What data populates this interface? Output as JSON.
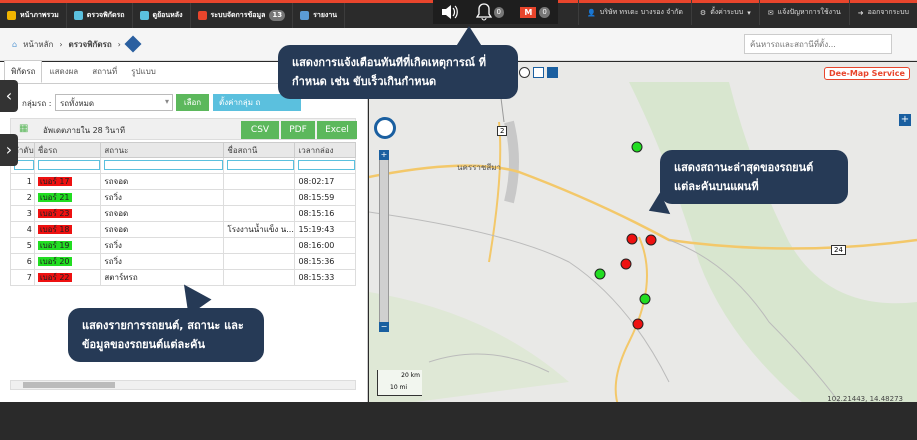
{
  "topnav": {
    "items": [
      {
        "label": "หน้าภาพรวม",
        "color": "#f0b400"
      },
      {
        "label": "ตรวจพิกัดรถ",
        "color": "#5bc0de"
      },
      {
        "label": "ดูย้อนหลัง",
        "color": "#5bc0de"
      },
      {
        "label": "ระบบจัดการข้อมูล",
        "color": "#e8452c",
        "badge": "13"
      },
      {
        "label": "รายงาน",
        "color": "#5b9bd5"
      }
    ],
    "alerts": {
      "bell_count": "0",
      "m_label": "M",
      "m_count": "0"
    },
    "company": "บริษัท ทรเดะ บางรอง จำกัด",
    "settings": "ตั้งค่าระบบ",
    "report_issue": "แจ้งปัญหาการใช้งาน",
    "logout": "ออกจากระบบ"
  },
  "breadcrumb": {
    "home": "หน้าหลัก",
    "current": "ตรวจพิกัดรถ"
  },
  "search": {
    "placeholder": "ค้นหารถและสถานีที่ตั้ง..."
  },
  "tabs": [
    "พิกัดรถ",
    "แสดงผล",
    "สถานที่",
    "รูปแบบ"
  ],
  "filter": {
    "label": "กลุ่มรถ :",
    "selected": "รถทั้งหมด",
    "go": "เลือก",
    "settings": "ตั้งค่ากลุ่ม ถ"
  },
  "toolbar": {
    "update_text": "อัพเดตภายใน 28 วินาที",
    "csv": "CSV",
    "pdf": "PDF",
    "excel": "Excel"
  },
  "table": {
    "headers": [
      "ลำดับ",
      "ชื่อรถ",
      "สถานะ",
      "ชื่อสถานี",
      "เวลากล่อง"
    ],
    "rows": [
      {
        "no": "1",
        "plate": "เบอร์ 17",
        "plate_color": "red",
        "status": "รถจอด",
        "station": "",
        "time": "08:02:17"
      },
      {
        "no": "2",
        "plate": "เบอร์ 21",
        "plate_color": "green",
        "status": "รถวิ่ง",
        "station": "",
        "time": "08:15:59"
      },
      {
        "no": "3",
        "plate": "เบอร์ 23",
        "plate_color": "red",
        "status": "รถจอด",
        "station": "",
        "time": "08:15:16"
      },
      {
        "no": "4",
        "plate": "เบอร์ 18",
        "plate_color": "red",
        "status": "รถจอด",
        "station": "โรงงานน้ำแข็ง น...",
        "time": "15:19:43"
      },
      {
        "no": "5",
        "plate": "เบอร์ 19",
        "plate_color": "green",
        "status": "รถวิ่ง",
        "station": "",
        "time": "08:16:00"
      },
      {
        "no": "6",
        "plate": "เบอร์ 20",
        "plate_color": "green",
        "status": "รถวิ่ง",
        "station": "",
        "time": "08:15:36"
      },
      {
        "no": "7",
        "plate": "เบอร์ 22",
        "plate_color": "red",
        "status": "สตาร์ทรถ",
        "station": "",
        "time": "08:15:33"
      }
    ]
  },
  "map": {
    "service_label": "Dee-Map Service",
    "city_label": "นครราชสีมา",
    "scale_km": "20 km",
    "scale_mi": "10 mi",
    "coords": "102.21443, 14.48273",
    "route_2": "2",
    "route_24": "24"
  },
  "callouts": {
    "alert": "แสดงการแจ้งเตือนทันทีที่เกิดเหตุการณ์ ที่กำหนด เช่น ขับเร็วเกินกำหนด",
    "status": "แสดงสถานะล่าสุดของรถยนต์ แต่ละคันบนแผนที่",
    "list": "แสดงรายการรถยนต์, สถานะ และ ข้อมูลของรถยนต์แต่ละคัน"
  }
}
